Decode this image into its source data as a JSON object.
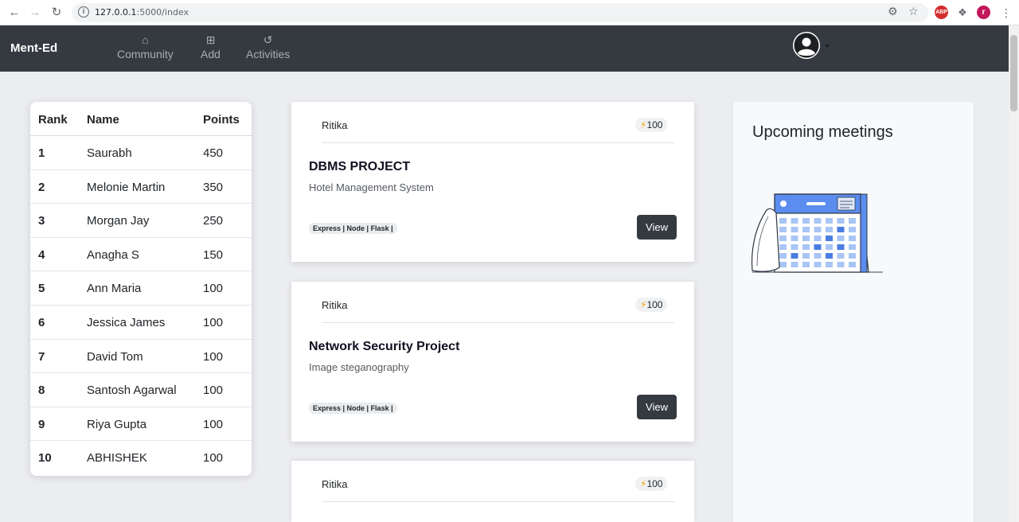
{
  "browser": {
    "url_host": "127.0.0.1",
    "url_rest": ":5000/index",
    "profile_initial": "r",
    "extension_label": "ABP"
  },
  "navbar": {
    "brand": "Ment-Ed",
    "items": [
      {
        "label": "Community",
        "icon": "home-icon"
      },
      {
        "label": "Add",
        "icon": "plus-square-icon"
      },
      {
        "label": "Activities",
        "icon": "history-icon"
      }
    ]
  },
  "leaderboard": {
    "headers": {
      "rank": "Rank",
      "name": "Name",
      "points": "Points"
    },
    "rows": [
      {
        "rank": "1",
        "name": "Saurabh",
        "points": "450"
      },
      {
        "rank": "2",
        "name": "Melonie Martin",
        "points": "350"
      },
      {
        "rank": "3",
        "name": "Morgan Jay",
        "points": "250"
      },
      {
        "rank": "4",
        "name": "Anagha S",
        "points": "150"
      },
      {
        "rank": "5",
        "name": "Ann Maria",
        "points": "100"
      },
      {
        "rank": "6",
        "name": "Jessica James",
        "points": "100"
      },
      {
        "rank": "7",
        "name": "David Tom",
        "points": "100"
      },
      {
        "rank": "8",
        "name": "Santosh Agarwal",
        "points": "100"
      },
      {
        "rank": "9",
        "name": "Riya Gupta",
        "points": "100"
      },
      {
        "rank": "10",
        "name": "ABHISHEK",
        "points": "100"
      }
    ]
  },
  "projects": [
    {
      "author": "Ritika",
      "points": "100",
      "title": "DBMS PROJECT",
      "description": "Hotel Management System",
      "tags": "Express | Node | Flask |",
      "button": "View"
    },
    {
      "author": "Ritika",
      "points": "100",
      "title": "Network Security Project",
      "description": "Image steganography",
      "tags": "Express | Node | Flask |",
      "button": "View"
    },
    {
      "author": "Ritika",
      "points": "100",
      "title": "",
      "description": "",
      "tags": "",
      "button": ""
    }
  ],
  "meetings": {
    "title": "Upcoming meetings"
  },
  "colors": {
    "navbar": "#343a40",
    "accent_bolt": "#f0a500",
    "calendar_blue": "#5b8def"
  }
}
